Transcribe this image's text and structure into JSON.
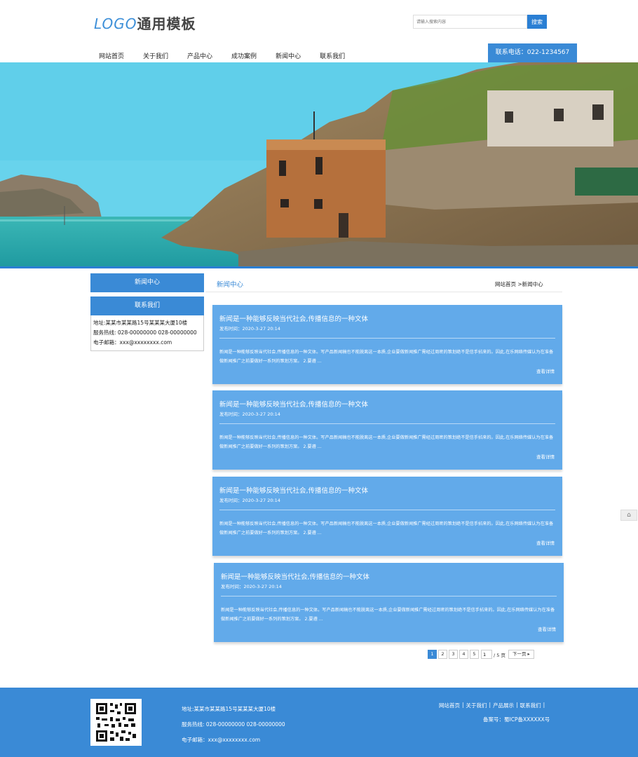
{
  "header": {
    "logo_en": "LOGO",
    "logo_cn": "通用模板",
    "search_placeholder": "请输入搜索内容",
    "search_button": "搜索",
    "phone": "联系电话：022-1234567"
  },
  "nav": [
    "网站首页",
    "关于我们",
    "产品中心",
    "成功案例",
    "新闻中心",
    "联系我们"
  ],
  "sidebar": {
    "news_title": "新闻中心",
    "contact_title": "联系我们",
    "contact_lines": [
      "地址:某某市某某路15号某某某大厦10楼",
      "服务热线: 028-00000000 028-00000000",
      "电子邮箱：xxx@xxxxxxxx.com"
    ]
  },
  "main": {
    "title": "新闻中心",
    "breadcrumb": "网站首页 >新闻中心"
  },
  "news": [
    {
      "title": "新闻是一种能够反映当代社会,传播信息的一种文体",
      "date": "发布时间：2020-3-27 20:14",
      "excerpt": "新闻是一种能够反映当代社会,传播信息的一种文体。写产品新闻稿也不能脱离这一本质,企业要做新闻推广需经过周密的策划绝不是信手拈来的。因此,在乐网络传媒认为在准备做新闻推广之前要做好一系列的策划方案。 2.要遵 ...",
      "more": "查看详情"
    },
    {
      "title": "新闻是一种能够反映当代社会,传播信息的一种文体",
      "date": "发布时间：2020-3-27 20:14",
      "excerpt": "新闻是一种能够反映当代社会,传播信息的一种文体。写产品新闻稿也不能脱离这一本质,企业要做新闻推广需经过周密的策划绝不是信手拈来的。因此,在乐网络传媒认为在准备做新闻推广之前要做好一系列的策划方案。 2.要遵 ...",
      "more": "查看详情"
    },
    {
      "title": "新闻是一种能够反映当代社会,传播信息的一种文体",
      "date": "发布时间：2020-3-27 20:14",
      "excerpt": "新闻是一种能够反映当代社会,传播信息的一种文体。写产品新闻稿也不能脱离这一本质,企业要做新闻推广需经过周密的策划绝不是信手拈来的。因此,在乐网络传媒认为在准备做新闻推广之前要做好一系列的策划方案。 2.要遵 ...",
      "more": "查看详情"
    },
    {
      "title": "新闻是一种能够反映当代社会,传播信息的一种文体",
      "date": "发布时间：2020-3-27 20:14",
      "excerpt": "新闻是一种能够反映当代社会,传播信息的一种文体。写产品新闻稿也不能脱离这一本质,企业要做新闻推广需经过周密的策划绝不是信手拈来的。因此,在乐网络传媒认为在准备做新闻推广之前要做好一系列的策划方案。 2.要遵 ...",
      "more": "查看详情"
    }
  ],
  "pager": {
    "pages": [
      "1",
      "2",
      "3",
      "4",
      "5"
    ],
    "input_value": "1",
    "total": "/ 5 页",
    "next": "下一页 ▸"
  },
  "footer": {
    "address": "地址:某某市某某路15号某某某大厦10楼",
    "hotline": "服务热线: 028-00000000 028-00000000",
    "email": "电子邮箱：xxx@xxxxxxxx.com",
    "links": [
      "网站首页",
      "关于我们",
      "产品展示",
      "联系我们"
    ],
    "icp": "备案号：蜀ICP备XXXXXX号"
  }
}
